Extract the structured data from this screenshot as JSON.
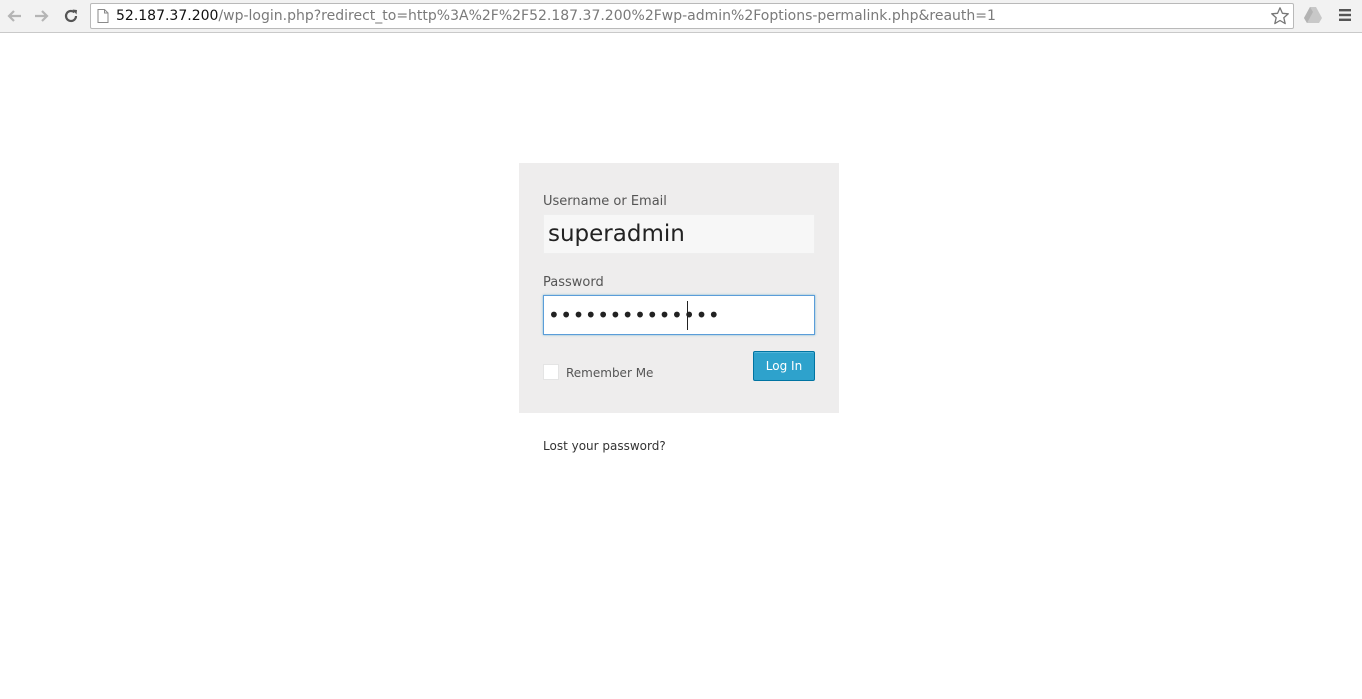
{
  "browser": {
    "url_host": "52.187.37.200",
    "url_rest": "/wp-login.php?redirect_to=http%3A%2F%2F52.187.37.200%2Fwp-admin%2Foptions-permalink.php&reauth=1"
  },
  "login": {
    "username_label": "Username or Email",
    "username_value": "superadmin",
    "password_label": "Password",
    "password_mask": "••••••••••••••",
    "remember_label": "Remember Me",
    "remember_checked": false,
    "login_button": "Log In",
    "lost_password_link": "Lost your password?"
  },
  "colors": {
    "button_bg": "#2ea2cc",
    "form_bg": "#eeeded",
    "focus_border": "#5b9dd9"
  }
}
